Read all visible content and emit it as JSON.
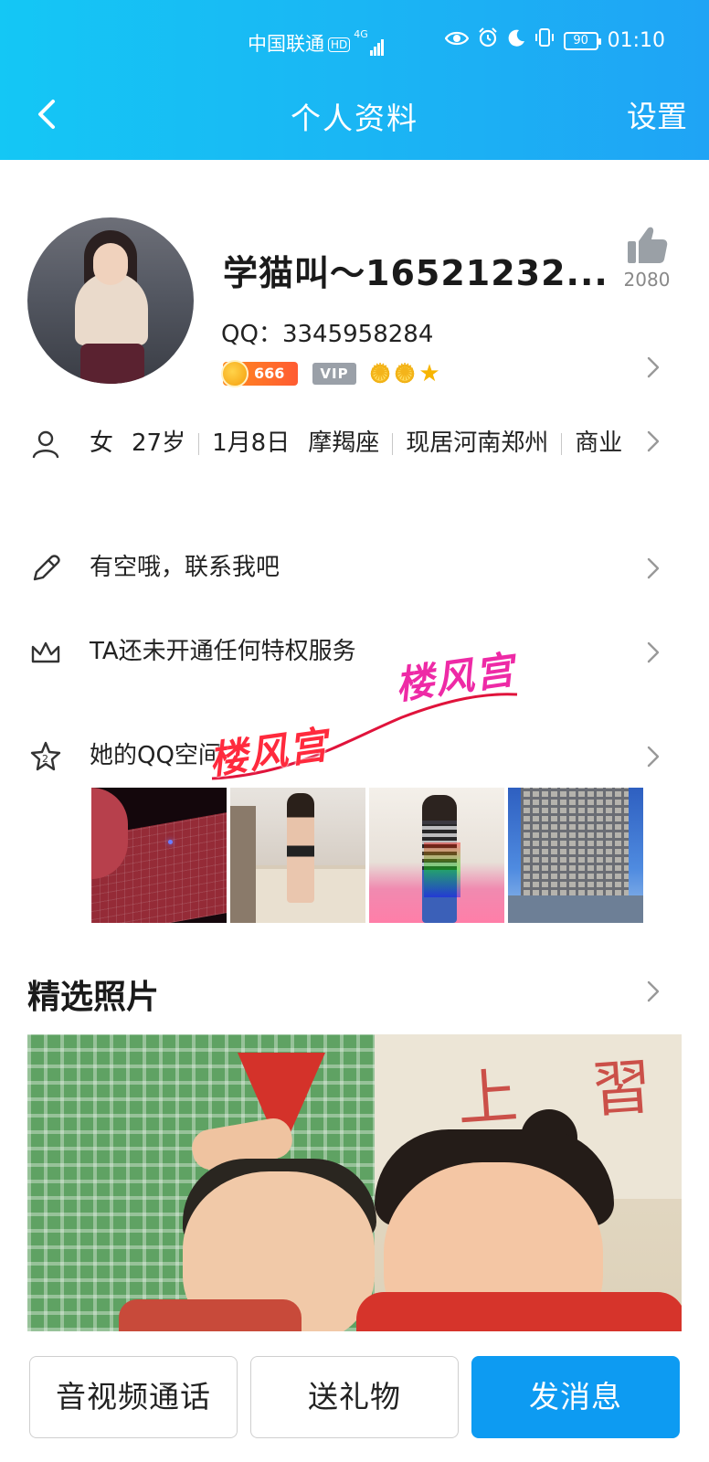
{
  "status_bar": {
    "carrier": "中国联通",
    "hd": "HD",
    "network": "4G",
    "battery": "90",
    "time": "01:10"
  },
  "nav": {
    "title": "个人资料",
    "settings": "设置"
  },
  "profile": {
    "nickname": "学猫叫～16521232...",
    "qq_label": "QQ：",
    "qq_number": "3345958284",
    "coin_badge": "666",
    "vip_badge": "VIP",
    "likes": "2080"
  },
  "info": {
    "gender": "女",
    "age": "27岁",
    "birthday": "1月8日",
    "zodiac": "摩羯座",
    "location": "现居河南郑州",
    "job": "商业",
    "signature": "有空哦，联系我吧",
    "privilege": "TA还未开通任何特权服务",
    "qzone": "她的QQ空间"
  },
  "watermark": {
    "text1": "楼风宫",
    "text2": "楼风宫"
  },
  "featured": {
    "title": "精选照片",
    "calligraphy": "上 習"
  },
  "actions": {
    "call": "音视频通话",
    "gift": "送礼物",
    "message": "发消息"
  },
  "colors": {
    "header_start": "#14c7f5",
    "header_end": "#1fa4f5",
    "primary_button": "#0d9bf2"
  }
}
